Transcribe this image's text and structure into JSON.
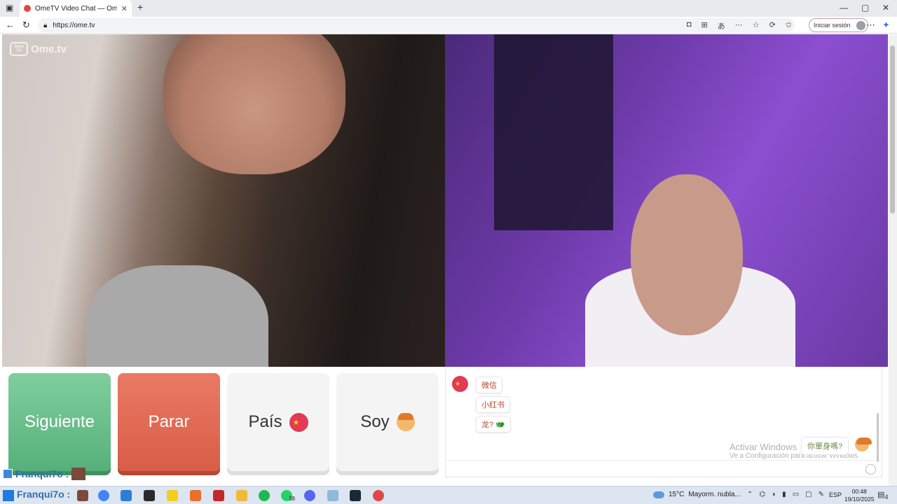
{
  "browser": {
    "tab_title": "OmeTV Video Chat — Omeg",
    "tab_close": "✕",
    "new_tab": "+",
    "url": "https://ome.tv",
    "signin_label": "Iniciar sesión",
    "window_controls": [
      "—",
      "▢",
      "✕"
    ]
  },
  "video": {
    "watermark_logo": "Ome TV",
    "watermark_text": "Ome.tv"
  },
  "controls": {
    "next_label": "Siguiente",
    "stop_label": "Parar",
    "country_label": "País",
    "country_flag": "★",
    "gender_label": "Soy"
  },
  "user": {
    "name": "Franqui7o :"
  },
  "chat": {
    "partner_flag": "★",
    "messages": [
      "微信",
      "小红书",
      "龙? 🐲"
    ],
    "my_message": "你單身嗎?",
    "windows_activation_title": "Activar Windows",
    "windows_activation_sub": "Ve a Configuración para activar Windows."
  },
  "taskbar": {
    "user_name": "Franqui7o :",
    "whatsapp_badge": "38",
    "weather_temp": "15°C",
    "weather_text": "Mayorm. nubla...",
    "language": "ESP",
    "time": "00:48",
    "date": "19/10/2025",
    "notifications": "4"
  },
  "colors": {
    "next": "#56b07a",
    "stop": "#d85d46",
    "neutral": "#f4f4f4",
    "chat_text": "#b4482e"
  }
}
